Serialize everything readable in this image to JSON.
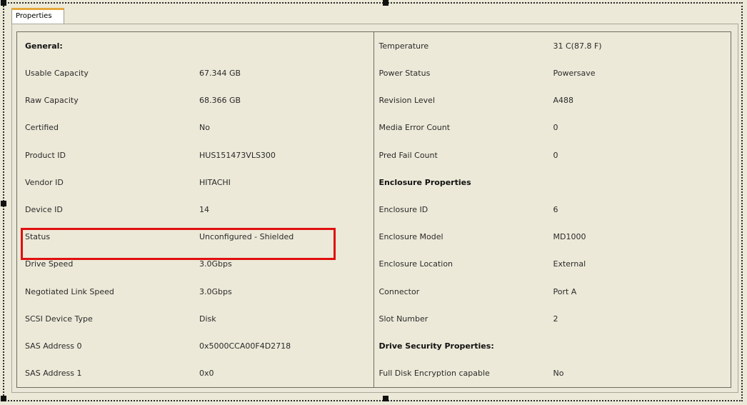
{
  "tab": {
    "label": "Properties"
  },
  "left_rows": [
    {
      "label": "General:",
      "value": "",
      "heading": true
    },
    {
      "label": "Usable Capacity",
      "value": "67.344 GB"
    },
    {
      "label": "Raw Capacity",
      "value": "68.366 GB"
    },
    {
      "label": "Certified",
      "value": "No"
    },
    {
      "label": "Product ID",
      "value": "HUS151473VLS300"
    },
    {
      "label": "Vendor ID",
      "value": "HITACHI"
    },
    {
      "label": "Device ID",
      "value": "14"
    },
    {
      "label": "Status",
      "value": "Unconfigured - Shielded"
    },
    {
      "label": "Drive Speed",
      "value": "3.0Gbps"
    },
    {
      "label": "Negotiated Link Speed",
      "value": "3.0Gbps"
    },
    {
      "label": "SCSI Device Type",
      "value": "Disk"
    },
    {
      "label": "SAS Address 0",
      "value": "0x5000CCA00F4D2718"
    },
    {
      "label": "SAS Address 1",
      "value": "0x0"
    }
  ],
  "right_rows": [
    {
      "label": "Temperature",
      "value": "31 C(87.8 F)"
    },
    {
      "label": "Power Status",
      "value": "Powersave"
    },
    {
      "label": "Revision Level",
      "value": "A488"
    },
    {
      "label": "Media Error Count",
      "value": "0"
    },
    {
      "label": "Pred Fail Count",
      "value": "0"
    },
    {
      "label": "Enclosure Properties",
      "value": "",
      "heading": true
    },
    {
      "label": "Enclosure ID",
      "value": "6"
    },
    {
      "label": "Enclosure Model",
      "value": "MD1000"
    },
    {
      "label": "Enclosure Location",
      "value": "External"
    },
    {
      "label": "Connector",
      "value": "Port A"
    },
    {
      "label": "Slot Number",
      "value": "2"
    },
    {
      "label": "Drive Security Properties:",
      "value": "",
      "heading": true
    },
    {
      "label": "Full Disk Encryption capable",
      "value": "No"
    }
  ],
  "colors": {
    "background": "#ece9d8",
    "grid_border": "#6f6d60",
    "highlight": "#e01010",
    "tab_accent": "#e7a83c"
  }
}
